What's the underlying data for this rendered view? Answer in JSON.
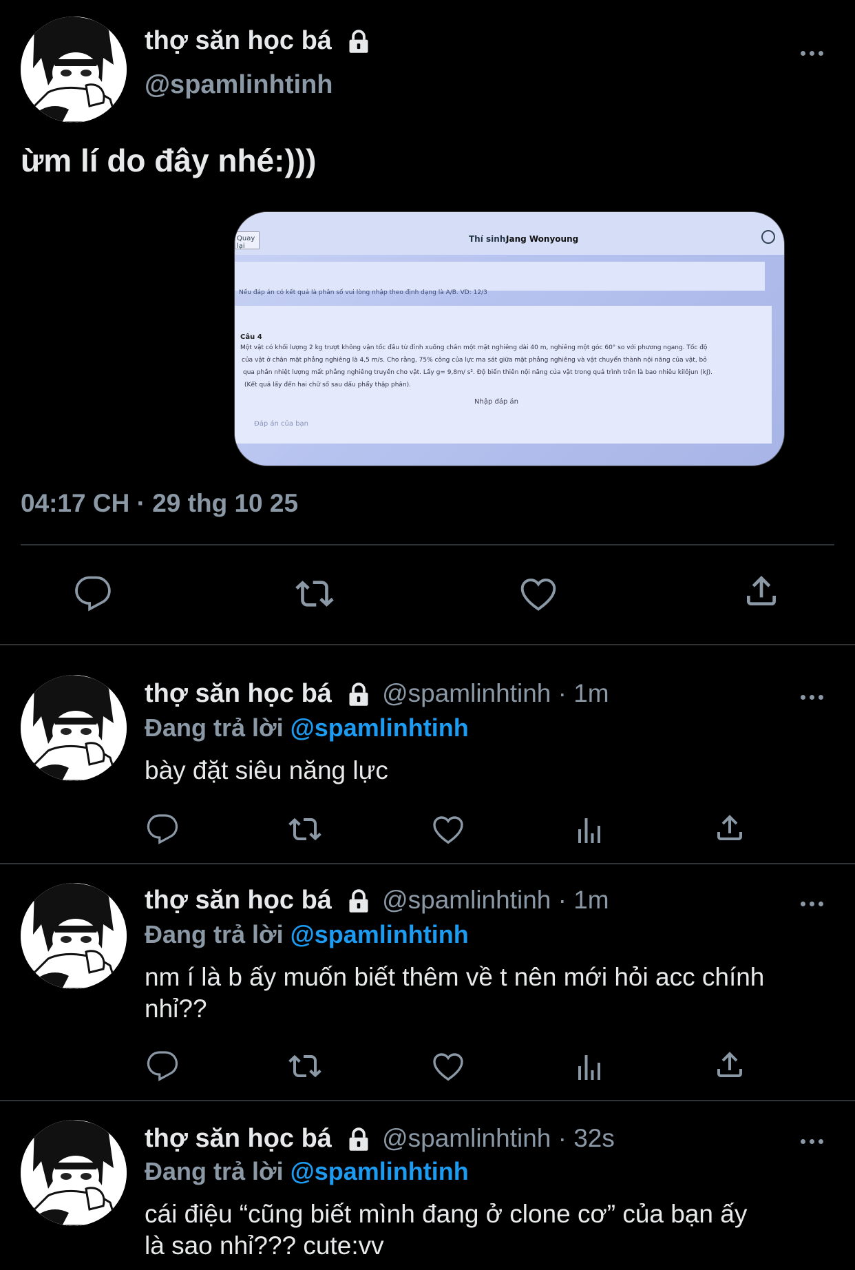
{
  "main_tweet": {
    "name": "thợ săn học bá",
    "handle": "@spamlinhtinh",
    "text": "ừm lí do đây nhé:)))",
    "timestamp": "04:17 CH · 29 thg 10 25",
    "image": {
      "back_label": "Quay lại",
      "candidate_label": "Thí sinh:",
      "candidate_name": "Jang Wonyoung",
      "note": "Nếu đáp án có kết quả là phân số vui lòng nhập theo định dạng là A/B. VD: 12/3",
      "question_title": "Câu 4",
      "question_line1": "Một vật có khối lượng 2 kg trượt không vận tốc đầu từ đỉnh xuống chân một mặt nghiêng dài 40 m, nghiêng một góc 60° so với phương ngang. Tốc độ",
      "question_line2": "của vật ở chân mặt phẳng nghiêng là 4,5 m/s. Cho rằng, 75% công của lực ma sát giữa mặt phẳng nghiêng và vật chuyển thành nội năng của vật, bỏ",
      "question_line3": "qua phần nhiệt lượng mất phẳng nghiêng truyền cho vật. Lấy g= 9,8m/ s². Độ biến thiên nội năng của vật trong quá trình trên là bao nhiêu kilôjun (kJ).",
      "question_line4": "(Kết quả lấy đến hai chữ số sau dấu phẩy thập phân).",
      "input_label": "Nhập đáp án",
      "answer_placeholder": "Đáp án của bạn"
    }
  },
  "replies": [
    {
      "name": "thợ săn học bá",
      "handle_time": "@spamlinhtinh · 1m",
      "reply_prefix": "Đang trả lời",
      "reply_handle": "@spamlinhtinh",
      "text_line1": "bày đặt siêu năng lực",
      "text_line2": ""
    },
    {
      "name": "thợ săn học bá",
      "handle_time": "@spamlinhtinh · 1m",
      "reply_prefix": "Đang trả lời",
      "reply_handle": "@spamlinhtinh",
      "text_line1": "nm í là b ấy muốn biết thêm về t nên mới hỏi acc chính",
      "text_line2": "nhỉ??"
    },
    {
      "name": "thợ săn học bá",
      "handle_time": "@spamlinhtinh · 32s",
      "reply_prefix": "Đang trả lời",
      "reply_handle": "@spamlinhtinh",
      "text_line1": "cái điệu “cũng biết mình đang ở clone cơ” của bạn ấy",
      "text_line2": "là sao nhỉ??? cute:vv"
    }
  ],
  "icons": {
    "reply": "reply-icon",
    "retweet": "retweet-icon",
    "like": "like-icon",
    "views": "views-icon",
    "share": "share-icon",
    "lock": "lock-icon",
    "more": "more-icon"
  },
  "colors": {
    "background": "#000000",
    "text": "#e7e9ea",
    "secondary": "#8b98a5",
    "link": "#1d9bf0",
    "divider": "#2f3336"
  }
}
